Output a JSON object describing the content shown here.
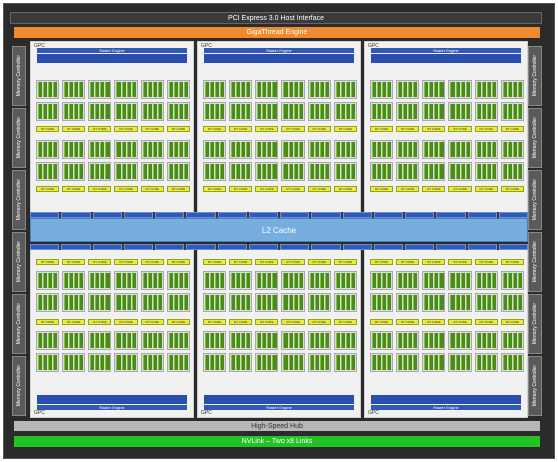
{
  "pcie_label": "PCI Express 3.0 Host Interface",
  "gigathread_label": "GigaThread Engine",
  "l2_label": "L2 Cache",
  "hub_label": "High-Speed Hub",
  "nvlink_label": "NVLink – Two x8 Links",
  "memory_controller_label": "Memory Controller",
  "gpc_label": "GPC",
  "raster_label": "Raster Engine",
  "rt_label": "RT CORE",
  "colors": {
    "background": "#2b2b2b",
    "gigathread": "#f08a2c",
    "l2": "#76aee0",
    "nvlink": "#22c322",
    "hub": "#b7b7b7",
    "raster": "#2f59b5",
    "sm_core": "#4a8c1c",
    "rt_core": "#e6ee3a"
  }
}
